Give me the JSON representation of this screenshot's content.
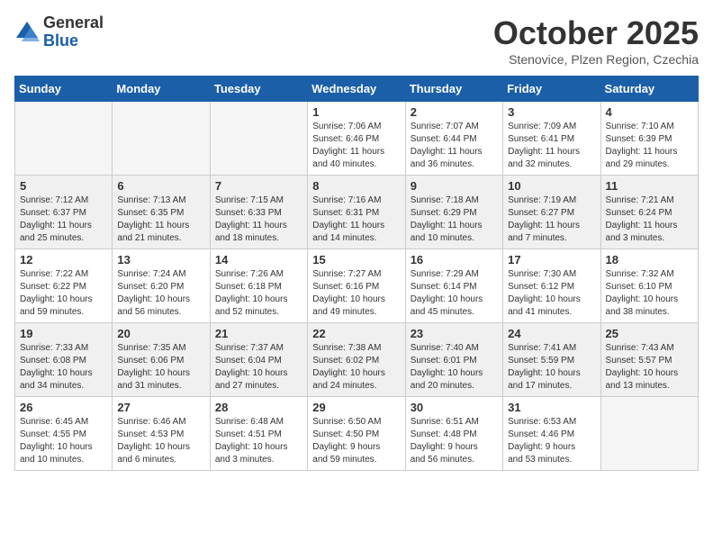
{
  "header": {
    "logo_general": "General",
    "logo_blue": "Blue",
    "month_title": "October 2025",
    "location": "Stenovice, Plzen Region, Czechia"
  },
  "weekdays": [
    "Sunday",
    "Monday",
    "Tuesday",
    "Wednesday",
    "Thursday",
    "Friday",
    "Saturday"
  ],
  "weeks": [
    [
      {
        "day": "",
        "info": "",
        "empty": true
      },
      {
        "day": "",
        "info": "",
        "empty": true
      },
      {
        "day": "",
        "info": "",
        "empty": true
      },
      {
        "day": "1",
        "info": "Sunrise: 7:06 AM\nSunset: 6:46 PM\nDaylight: 11 hours\nand 40 minutes.",
        "empty": false
      },
      {
        "day": "2",
        "info": "Sunrise: 7:07 AM\nSunset: 6:44 PM\nDaylight: 11 hours\nand 36 minutes.",
        "empty": false
      },
      {
        "day": "3",
        "info": "Sunrise: 7:09 AM\nSunset: 6:41 PM\nDaylight: 11 hours\nand 32 minutes.",
        "empty": false
      },
      {
        "day": "4",
        "info": "Sunrise: 7:10 AM\nSunset: 6:39 PM\nDaylight: 11 hours\nand 29 minutes.",
        "empty": false
      }
    ],
    [
      {
        "day": "5",
        "info": "Sunrise: 7:12 AM\nSunset: 6:37 PM\nDaylight: 11 hours\nand 25 minutes.",
        "empty": false
      },
      {
        "day": "6",
        "info": "Sunrise: 7:13 AM\nSunset: 6:35 PM\nDaylight: 11 hours\nand 21 minutes.",
        "empty": false
      },
      {
        "day": "7",
        "info": "Sunrise: 7:15 AM\nSunset: 6:33 PM\nDaylight: 11 hours\nand 18 minutes.",
        "empty": false
      },
      {
        "day": "8",
        "info": "Sunrise: 7:16 AM\nSunset: 6:31 PM\nDaylight: 11 hours\nand 14 minutes.",
        "empty": false
      },
      {
        "day": "9",
        "info": "Sunrise: 7:18 AM\nSunset: 6:29 PM\nDaylight: 11 hours\nand 10 minutes.",
        "empty": false
      },
      {
        "day": "10",
        "info": "Sunrise: 7:19 AM\nSunset: 6:27 PM\nDaylight: 11 hours\nand 7 minutes.",
        "empty": false
      },
      {
        "day": "11",
        "info": "Sunrise: 7:21 AM\nSunset: 6:24 PM\nDaylight: 11 hours\nand 3 minutes.",
        "empty": false
      }
    ],
    [
      {
        "day": "12",
        "info": "Sunrise: 7:22 AM\nSunset: 6:22 PM\nDaylight: 10 hours\nand 59 minutes.",
        "empty": false
      },
      {
        "day": "13",
        "info": "Sunrise: 7:24 AM\nSunset: 6:20 PM\nDaylight: 10 hours\nand 56 minutes.",
        "empty": false
      },
      {
        "day": "14",
        "info": "Sunrise: 7:26 AM\nSunset: 6:18 PM\nDaylight: 10 hours\nand 52 minutes.",
        "empty": false
      },
      {
        "day": "15",
        "info": "Sunrise: 7:27 AM\nSunset: 6:16 PM\nDaylight: 10 hours\nand 49 minutes.",
        "empty": false
      },
      {
        "day": "16",
        "info": "Sunrise: 7:29 AM\nSunset: 6:14 PM\nDaylight: 10 hours\nand 45 minutes.",
        "empty": false
      },
      {
        "day": "17",
        "info": "Sunrise: 7:30 AM\nSunset: 6:12 PM\nDaylight: 10 hours\nand 41 minutes.",
        "empty": false
      },
      {
        "day": "18",
        "info": "Sunrise: 7:32 AM\nSunset: 6:10 PM\nDaylight: 10 hours\nand 38 minutes.",
        "empty": false
      }
    ],
    [
      {
        "day": "19",
        "info": "Sunrise: 7:33 AM\nSunset: 6:08 PM\nDaylight: 10 hours\nand 34 minutes.",
        "empty": false
      },
      {
        "day": "20",
        "info": "Sunrise: 7:35 AM\nSunset: 6:06 PM\nDaylight: 10 hours\nand 31 minutes.",
        "empty": false
      },
      {
        "day": "21",
        "info": "Sunrise: 7:37 AM\nSunset: 6:04 PM\nDaylight: 10 hours\nand 27 minutes.",
        "empty": false
      },
      {
        "day": "22",
        "info": "Sunrise: 7:38 AM\nSunset: 6:02 PM\nDaylight: 10 hours\nand 24 minutes.",
        "empty": false
      },
      {
        "day": "23",
        "info": "Sunrise: 7:40 AM\nSunset: 6:01 PM\nDaylight: 10 hours\nand 20 minutes.",
        "empty": false
      },
      {
        "day": "24",
        "info": "Sunrise: 7:41 AM\nSunset: 5:59 PM\nDaylight: 10 hours\nand 17 minutes.",
        "empty": false
      },
      {
        "day": "25",
        "info": "Sunrise: 7:43 AM\nSunset: 5:57 PM\nDaylight: 10 hours\nand 13 minutes.",
        "empty": false
      }
    ],
    [
      {
        "day": "26",
        "info": "Sunrise: 6:45 AM\nSunset: 4:55 PM\nDaylight: 10 hours\nand 10 minutes.",
        "empty": false
      },
      {
        "day": "27",
        "info": "Sunrise: 6:46 AM\nSunset: 4:53 PM\nDaylight: 10 hours\nand 6 minutes.",
        "empty": false
      },
      {
        "day": "28",
        "info": "Sunrise: 6:48 AM\nSunset: 4:51 PM\nDaylight: 10 hours\nand 3 minutes.",
        "empty": false
      },
      {
        "day": "29",
        "info": "Sunrise: 6:50 AM\nSunset: 4:50 PM\nDaylight: 9 hours\nand 59 minutes.",
        "empty": false
      },
      {
        "day": "30",
        "info": "Sunrise: 6:51 AM\nSunset: 4:48 PM\nDaylight: 9 hours\nand 56 minutes.",
        "empty": false
      },
      {
        "day": "31",
        "info": "Sunrise: 6:53 AM\nSunset: 4:46 PM\nDaylight: 9 hours\nand 53 minutes.",
        "empty": false
      },
      {
        "day": "",
        "info": "",
        "empty": true
      }
    ]
  ]
}
